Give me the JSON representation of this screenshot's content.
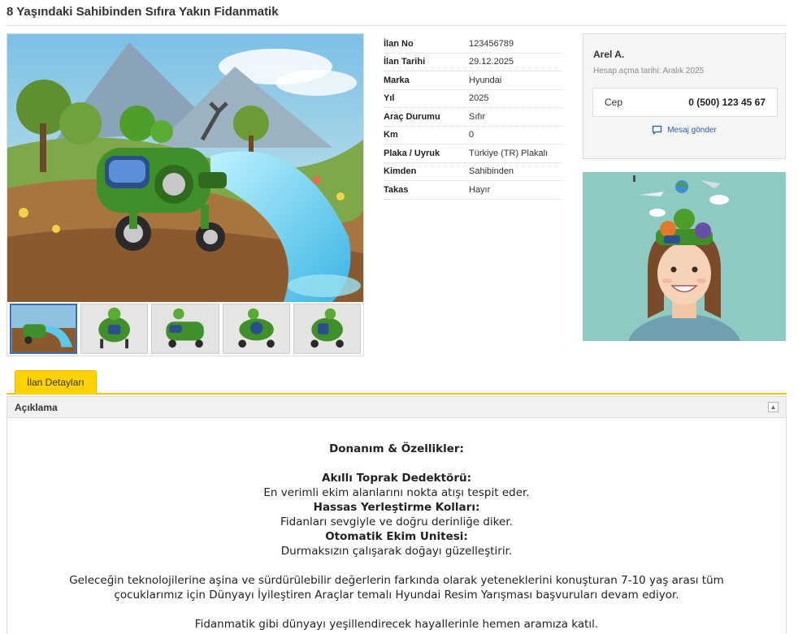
{
  "listing": {
    "title": "8 Yaşındaki Sahibinden Sıfıra Yakın Fidanmatik"
  },
  "details": [
    {
      "key": "İlan No",
      "value": "123456789"
    },
    {
      "key": "İlan Tarihi",
      "value": "29.12.2025"
    },
    {
      "key": "Marka",
      "value": "Hyundai"
    },
    {
      "key": "Yıl",
      "value": "2025"
    },
    {
      "key": "Araç Durumu",
      "value": "Sıfır"
    },
    {
      "key": "Km",
      "value": "0"
    },
    {
      "key": "Plaka / Uyruk",
      "value": "Türkiye (TR) Plakalı"
    },
    {
      "key": "Kimden",
      "value": "Sahibinden"
    },
    {
      "key": "Takas",
      "value": "Hayır"
    }
  ],
  "seller": {
    "name": "Arel A.",
    "since": "Hesap açma tarihi: Aralık 2025",
    "phone_label": "Cep",
    "phone": "0 (500) 123 45 67",
    "message_label": "Mesaj gönder"
  },
  "tabs": {
    "active": "İlan Detayları"
  },
  "description": {
    "header": "Açıklama",
    "heading": "Donanım & Özellikler:",
    "features": [
      {
        "title": "Akıllı Toprak Dedektörü:",
        "text": "En verimli ekim alanlarını nokta atışı tespit eder."
      },
      {
        "title": "Hassas Yerleştirme Kolları:",
        "text": "Fidanları sevgiyle ve doğru derinliğe diker."
      },
      {
        "title": "Otomatik Ekim Unitesi:",
        "text": "Durmaksızın çalışarak doğayı güzelleştirir."
      }
    ],
    "paragraph1": "Geleceğin teknolojilerine aşina ve sürdürülebilir değerlerin farkında olarak yeteneklerini konuşturan 7-10 yaş arası tüm",
    "paragraph2": "çocuklarımız için Dünyayı İyileştiren Araçlar temalı Hyundai Resim Yarışması başvuruları devam ediyor.",
    "closing": "Fidanmatik gibi dünyayı yeşillendirecek hayallerinle hemen aramıza katıl."
  },
  "icons": {
    "message": "chat-bubble-icon",
    "collapse": "chevron-up-icon"
  },
  "colors": {
    "accent_yellow": "#ffd200",
    "link_blue": "#2b5cab",
    "thumb_active": "#2d6fc3"
  }
}
